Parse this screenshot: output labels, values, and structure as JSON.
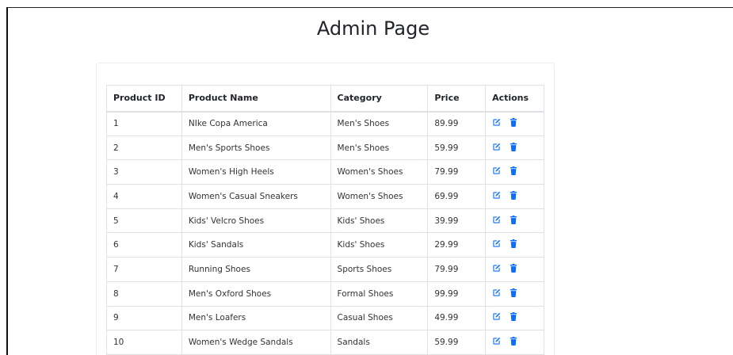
{
  "page": {
    "title": "Admin Page"
  },
  "colors": {
    "accent": "#0d6efd"
  },
  "table": {
    "headers": [
      "Product ID",
      "Product Name",
      "Category",
      "Price",
      "Actions"
    ],
    "rows": [
      {
        "id": "1",
        "name": "NIke Copa America",
        "category": "Men's Shoes",
        "price": "89.99"
      },
      {
        "id": "2",
        "name": "Men's Sports Shoes",
        "category": "Men's Shoes",
        "price": "59.99"
      },
      {
        "id": "3",
        "name": "Women's High Heels",
        "category": "Women's Shoes",
        "price": "79.99"
      },
      {
        "id": "4",
        "name": "Women's Casual Sneakers",
        "category": "Women's Shoes",
        "price": "69.99"
      },
      {
        "id": "5",
        "name": "Kids' Velcro Shoes",
        "category": "Kids' Shoes",
        "price": "39.99"
      },
      {
        "id": "6",
        "name": "Kids' Sandals",
        "category": "Kids' Shoes",
        "price": "29.99"
      },
      {
        "id": "7",
        "name": "Running Shoes",
        "category": "Sports Shoes",
        "price": "79.99"
      },
      {
        "id": "8",
        "name": "Men's Oxford Shoes",
        "category": "Formal Shoes",
        "price": "99.99"
      },
      {
        "id": "9",
        "name": "Men's Loafers",
        "category": "Casual Shoes",
        "price": "49.99"
      },
      {
        "id": "10",
        "name": "Women's Wedge Sandals",
        "category": "Sandals",
        "price": "59.99"
      }
    ],
    "row_icons": [
      "edit-icon",
      "trash-icon"
    ]
  }
}
